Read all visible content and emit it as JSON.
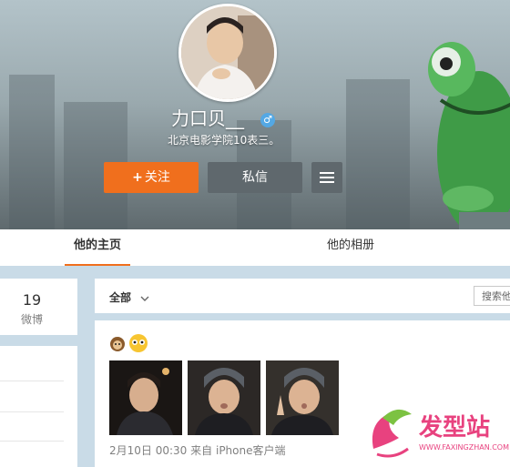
{
  "profile": {
    "name": "力口贝__",
    "gender_symbol": "♂",
    "bio": "北京电影学院10表三。"
  },
  "actions": {
    "follow_plus": "+",
    "follow_label": "关注",
    "message_label": "私信",
    "more_icon": "menu-icon"
  },
  "tabs": [
    {
      "label": "他的主页",
      "active": true
    },
    {
      "label": "他的相册",
      "active": false
    }
  ],
  "stats": {
    "weibo_count": "19",
    "weibo_label": "微博"
  },
  "feed_filter": {
    "all_label": "全部",
    "search_placeholder": "搜索他"
  },
  "post": {
    "emoji_icons": [
      "monkey-emoji-icon",
      "cute-face-emoji-icon"
    ],
    "photo_count": 3,
    "time": "2月10日 00:30",
    "source_prefix": "来自",
    "source": "iPhone客户端"
  },
  "watermark": {
    "brand": "发型站",
    "url": "WWW.FAXINGZHAN.COM"
  },
  "colors": {
    "accent_orange": "#f06f1d",
    "button_gray": "#5f686d",
    "gender_blue": "#54a8e4",
    "brand_pink": "#e8427f",
    "page_bg": "#c9dbe7"
  }
}
